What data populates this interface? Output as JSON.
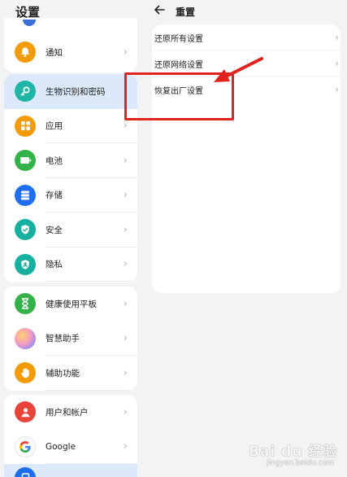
{
  "left": {
    "title": "设置",
    "items": [
      {
        "label": "通知",
        "icon": "bell-icon",
        "color": "#f39c0b"
      },
      {
        "label": "生物识别和密码",
        "icon": "key-icon",
        "color": "#21b5a8"
      },
      {
        "label": "应用",
        "icon": "apps-grid-icon",
        "color": "#f39c0b"
      },
      {
        "label": "电池",
        "icon": "battery-icon",
        "color": "#33b24a"
      },
      {
        "label": "存储",
        "icon": "storage-icon",
        "color": "#1f6ef2"
      },
      {
        "label": "安全",
        "icon": "shield-icon",
        "color": "#16b0a0"
      },
      {
        "label": "隐私",
        "icon": "privacy-icon",
        "color": "#16b0a0"
      },
      {
        "label": "健康使用平板",
        "icon": "hourglass-icon",
        "color": "#33b24a"
      },
      {
        "label": "智慧助手",
        "icon": "assistant-icon",
        "color": "#c98fe0"
      },
      {
        "label": "辅助功能",
        "icon": "hand-icon",
        "color": "#f39c0b"
      },
      {
        "label": "用户和帐户",
        "icon": "user-icon",
        "color": "#e8443a"
      },
      {
        "label": "Google",
        "icon": "google-icon",
        "color": "#ffffff"
      }
    ]
  },
  "right": {
    "title": "重置",
    "options": [
      {
        "label": "还原所有设置"
      },
      {
        "label": "还原网络设置"
      },
      {
        "label": "恢复出厂设置"
      }
    ]
  },
  "watermark": {
    "main": "Bai du 经验",
    "sub": "jingyan.baidu.com"
  },
  "colors": {
    "annotation": "#e1231e",
    "selected_row": "#dbe9fb"
  }
}
